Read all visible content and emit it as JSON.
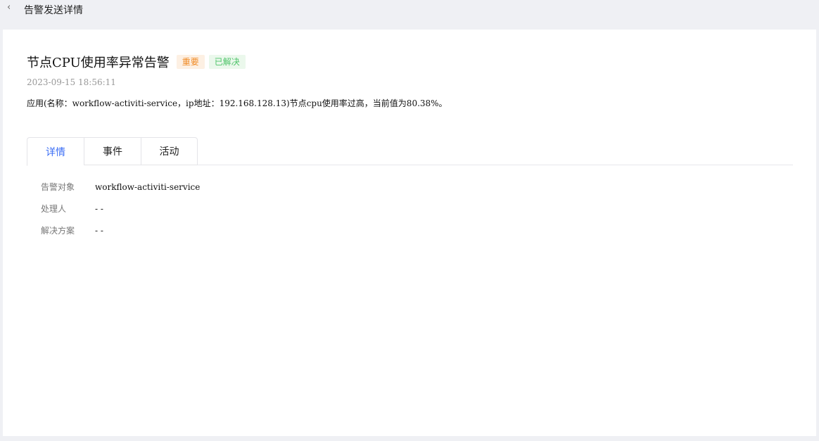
{
  "header": {
    "back_icon": "‹",
    "title": "告警发送详情"
  },
  "alert": {
    "title": "节点CPU使用率异常告警",
    "severity": "重要",
    "status": "已解决",
    "time": "2023-09-15 18:56:11",
    "description": "应用(名称：workflow-activiti-service，ip地址：192.168.128.13)节点cpu使用率过高，当前值为80.38%。"
  },
  "tabs": [
    {
      "label": "详情"
    },
    {
      "label": "事件"
    },
    {
      "label": "活动"
    }
  ],
  "details": [
    {
      "label": "告警对象",
      "value": "workflow-activiti-service"
    },
    {
      "label": "处理人",
      "value": "- -"
    },
    {
      "label": "解决方案",
      "value": "- -"
    }
  ],
  "colors": {
    "accent": "#3b6ef5",
    "severity": "#f08a24",
    "resolved": "#4fc46a"
  }
}
